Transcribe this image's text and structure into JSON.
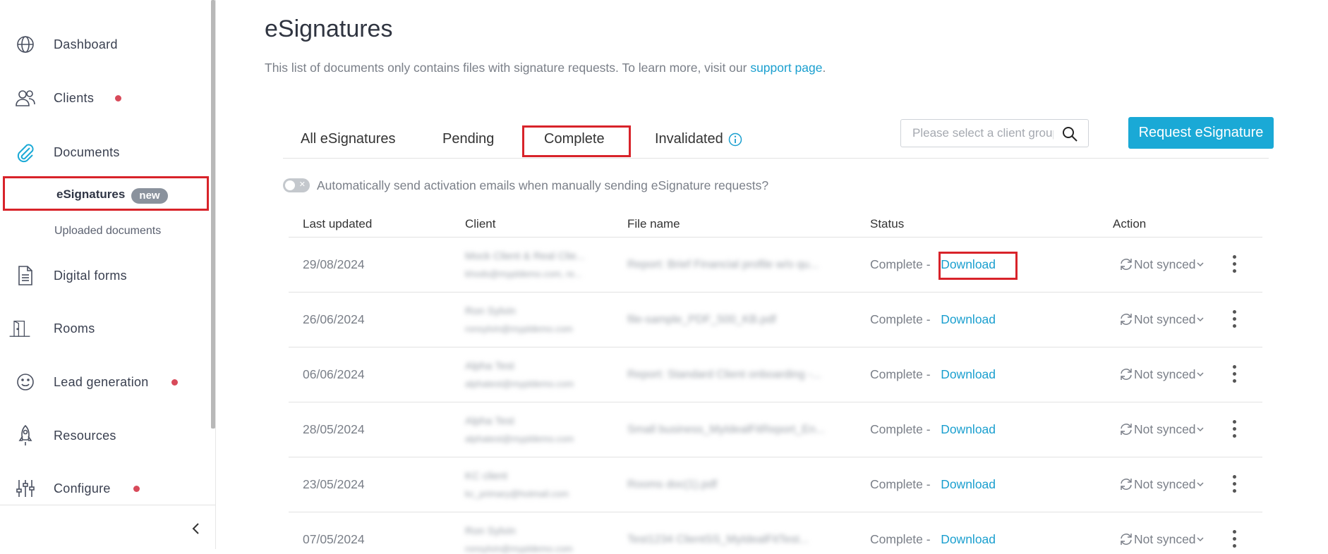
{
  "sidebar": {
    "items": [
      {
        "label": "Dashboard",
        "icon": "globe-icon"
      },
      {
        "label": "Clients",
        "icon": "users-icon"
      },
      {
        "label": "Documents",
        "icon": "paperclip-icon"
      },
      {
        "label": "Digital forms",
        "icon": "document-icon"
      },
      {
        "label": "Rooms",
        "icon": "door-icon"
      },
      {
        "label": "Lead generation",
        "icon": "smiley-icon"
      },
      {
        "label": "Resources",
        "icon": "rocket-icon"
      },
      {
        "label": "Configure",
        "icon": "sliders-icon"
      }
    ],
    "sub_items": {
      "esignatures": "eSignatures",
      "new_badge": "new",
      "uploaded": "Uploaded documents"
    },
    "dot_color": "#d84a5a"
  },
  "header": {
    "title": "eSignatures",
    "intro_text": "This list of documents only contains files with signature requests. To learn more, visit our ",
    "intro_link": "support page",
    "intro_end": "."
  },
  "tabs": [
    {
      "label": "All eSignatures"
    },
    {
      "label": "Pending"
    },
    {
      "label": "Complete",
      "active": true
    },
    {
      "label": "Invalidated"
    }
  ],
  "search": {
    "placeholder": "Please select a client group"
  },
  "request_button": "Request eSignature",
  "toggle_label": "Automatically send activation emails when manually sending eSignature requests?",
  "table": {
    "columns": [
      "Last updated",
      "Client",
      "File name",
      "Status",
      "Action"
    ],
    "rows": [
      {
        "date": "29/08/2024",
        "client_name": "Mock Client & Real Clie...",
        "client_email": "khods@mypldemo.com, re...",
        "file": "Report: Brief Financial profile w/o qu...",
        "status": "Complete -",
        "download": "Download",
        "sync": "Not synced"
      },
      {
        "date": "26/06/2024",
        "client_name": "Ron Sylvin",
        "client_email": "ronsylvin@mypldemo.com",
        "file": "file-sample_PDF_500_KB.pdf",
        "status": "Complete -",
        "download": "Download",
        "sync": "Not synced"
      },
      {
        "date": "06/06/2024",
        "client_name": "Alpha Test",
        "client_email": "alphatest@mypldemo.com",
        "file": "Report: Standard Client onboarding -...",
        "status": "Complete -",
        "download": "Download",
        "sync": "Not synced"
      },
      {
        "date": "28/05/2024",
        "client_name": "Alpha Test",
        "client_email": "alphatest@mypldemo.com",
        "file": "Small business_MyIdealFitReport_En...",
        "status": "Complete -",
        "download": "Download",
        "sync": "Not synced"
      },
      {
        "date": "23/05/2024",
        "client_name": "KC client",
        "client_email": "kc_primary@hotmail.com",
        "file": "Rooms doc(1).pdf",
        "status": "Complete -",
        "download": "Download",
        "sync": "Not synced"
      },
      {
        "date": "07/05/2024",
        "client_name": "Ron Sylvin",
        "client_email": "ronsylvin@mypldemo.com",
        "file": "Test1234 ClientSS_MyIdealFitTest...",
        "status": "Complete -",
        "download": "Download",
        "sync": "Not synced"
      }
    ]
  },
  "colors": {
    "accent": "#1aa9d6",
    "link": "#1a9fcf",
    "highlight": "#d8232a"
  }
}
